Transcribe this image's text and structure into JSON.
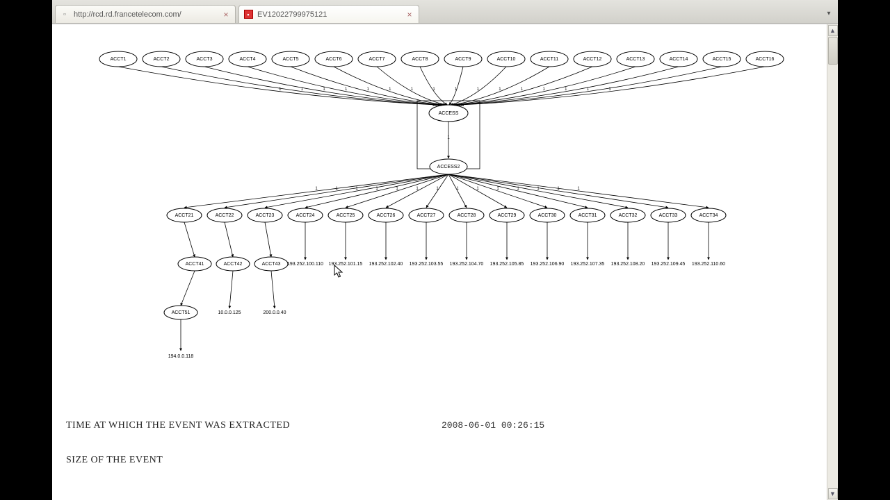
{
  "tabs": [
    {
      "title": "http://rcd.rd.francetelecom.com/",
      "favicon": "page",
      "active": false
    },
    {
      "title": "EV12022799975121",
      "favicon": "red",
      "active": true
    }
  ],
  "graph": {
    "top_row": [
      "ACCT1",
      "ACCT2",
      "ACCT3",
      "ACCT4",
      "ACCT5",
      "ACCT6",
      "ACCT7",
      "ACCT8",
      "ACCT9",
      "ACCT10",
      "ACCT11",
      "ACCT12",
      "ACCT13",
      "ACCT14",
      "ACCT15",
      "ACCT16"
    ],
    "hub_top": "ACCESS",
    "hub_mid": "ACCESS2",
    "mid_row": [
      "ACCT21",
      "ACCT22",
      "ACCT23",
      "ACCT24",
      "ACCT25",
      "ACCT26",
      "ACCT27",
      "ACCT28",
      "ACCT29",
      "ACCT30",
      "ACCT31",
      "ACCT32",
      "ACCT33",
      "ACCT34"
    ],
    "sub_ellipses": [
      "ACCT41",
      "ACCT42",
      "ACCT43"
    ],
    "sub_leaf_texts": [
      "193.252.100.110",
      "193.252.101.15",
      "193.252.102.40",
      "193.252.103.55",
      "193.252.104.70",
      "193.252.105.85",
      "193.252.106.90",
      "193.252.107.35",
      "193.252.108.20",
      "193.252.109.45",
      "193.252.110.60"
    ],
    "deep_ellipse": "ACCT51",
    "deep_texts": [
      "10.0.0.125",
      "200.0.0.40"
    ],
    "final_leaf": "194.0.0.118",
    "edge_label": "1"
  },
  "info": {
    "time_label": "TIME AT WHICH THE EVENT WAS EXTRACTED",
    "time_value": "2008-06-01 00:26:15",
    "size_label": "SIZE OF THE EVENT"
  }
}
